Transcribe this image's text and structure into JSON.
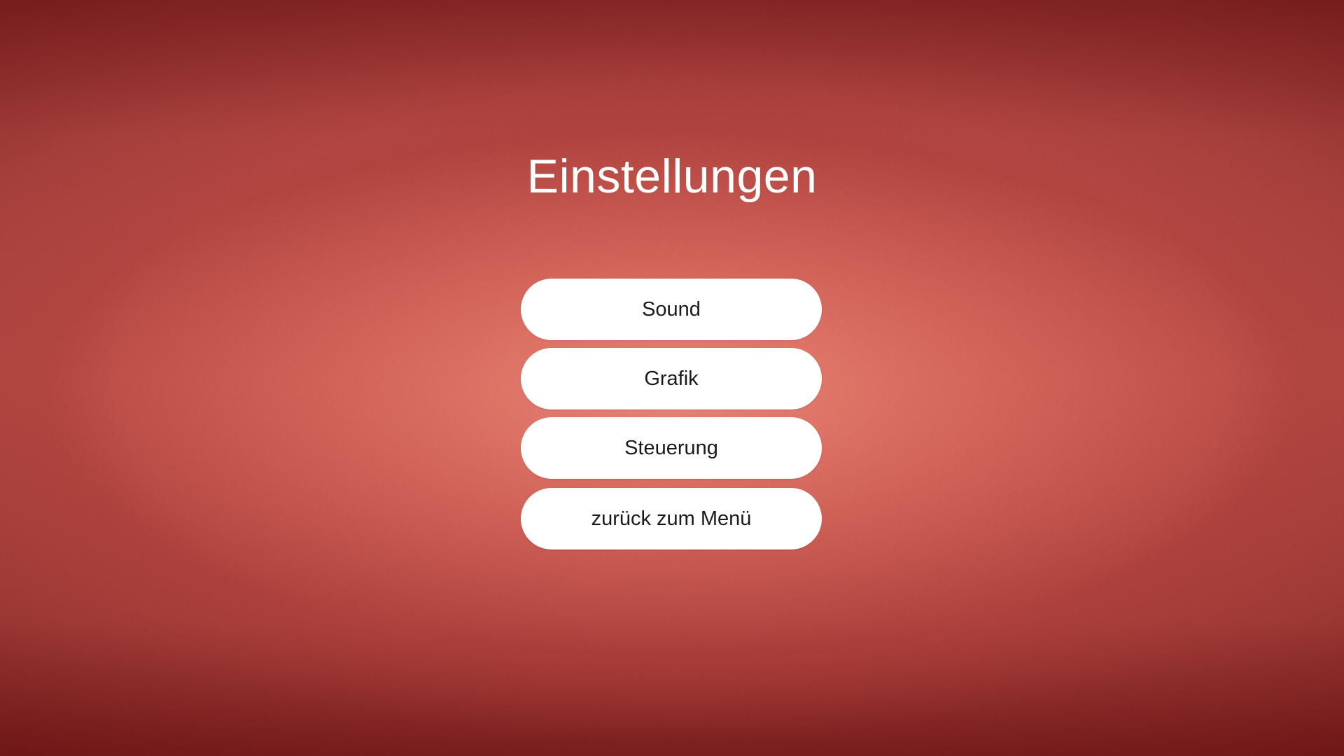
{
  "screen": {
    "title": "Einstellungen"
  },
  "menu": {
    "items": [
      {
        "label": "Sound"
      },
      {
        "label": "Grafik"
      },
      {
        "label": "Steuerung"
      },
      {
        "label": "zurück zum Menü"
      }
    ]
  },
  "colors": {
    "background_center": "#e8877a",
    "background_edge": "#8c2a2a",
    "button_fill": "#ffffff",
    "button_text": "#1a1a1a",
    "title_text": "#ffffff"
  }
}
